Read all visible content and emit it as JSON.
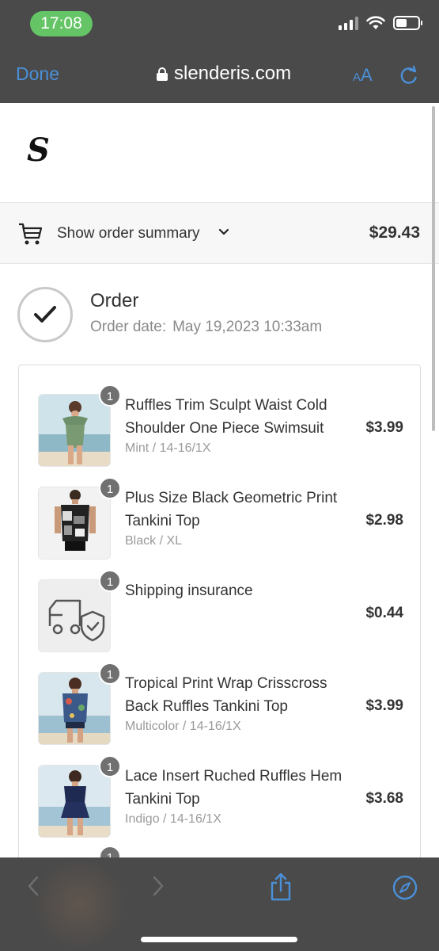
{
  "status": {
    "time": "17:08"
  },
  "browser": {
    "done_label": "Done",
    "url": "slenderis.com",
    "text_size_label_small": "A",
    "text_size_label_large": "A",
    "icons": [
      "lock-icon",
      "reload-icon",
      "back-icon",
      "forward-icon",
      "share-icon",
      "compass-icon"
    ]
  },
  "page": {
    "logo": "S",
    "summary": {
      "label": "Show order summary",
      "total": "$29.43"
    },
    "order": {
      "title": "Order",
      "date_label": "Order date:",
      "date_value": "May 19,2023 10:33am"
    },
    "items": [
      {
        "qty": "1",
        "name": "Ruffles Trim Sculpt Waist Cold Shoulder One Piece Swimsuit",
        "variant": "Mint / 14-16/1X",
        "price": "$3.99",
        "thumb": "green-swimsuit"
      },
      {
        "qty": "1",
        "name": "Plus Size Black Geometric Print Tankini Top",
        "variant": "Black / XL",
        "price": "$2.98",
        "thumb": "black-geo-tankini"
      },
      {
        "qty": "1",
        "name": "Shipping insurance",
        "variant": "",
        "price": "$0.44",
        "thumb": "truck-shield-icon"
      },
      {
        "qty": "1",
        "name": "Tropical Print Wrap Crisscross Back Ruffles Tankini Top",
        "variant": "Multicolor / 14-16/1X",
        "price": "$3.99",
        "thumb": "tropical-tankini"
      },
      {
        "qty": "1",
        "name": "Lace Insert Ruched Ruffles Hem Tankini Top",
        "variant": "Indigo / 14-16/1X",
        "price": "$3.68",
        "thumb": "indigo-tankini"
      }
    ]
  },
  "colors": {
    "status_green": "#64c466",
    "link_blue": "#4a90d9",
    "chrome_gray": "#4a4a4a"
  }
}
